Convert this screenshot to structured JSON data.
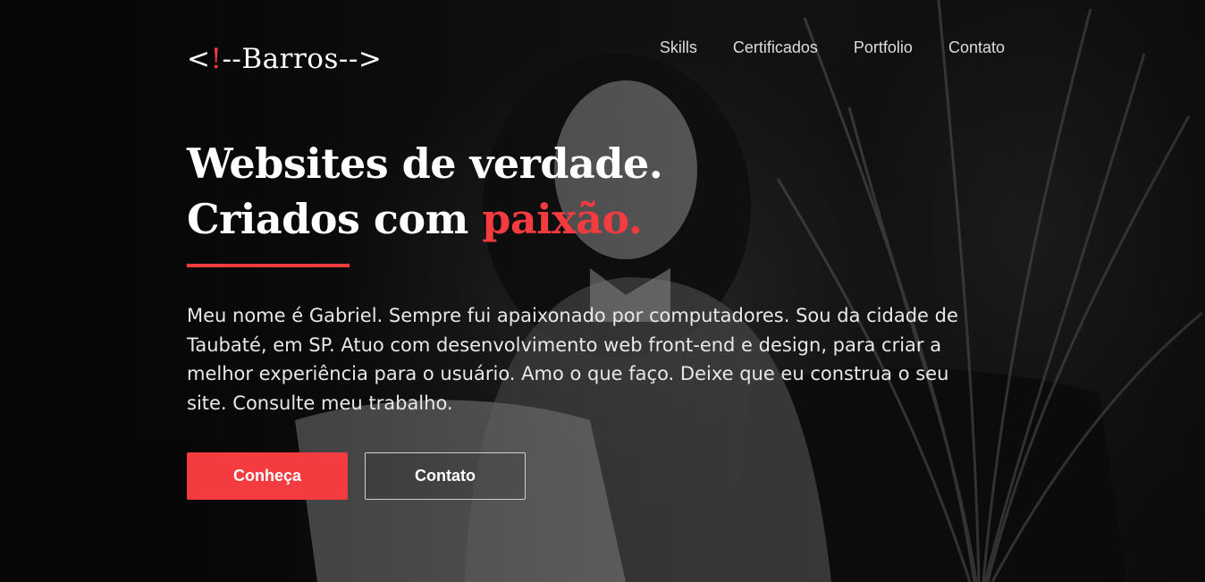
{
  "logo": {
    "prefix": "<",
    "bang": "!",
    "suffix": "--Barros-->"
  },
  "nav": {
    "items": [
      {
        "label": "Skills"
      },
      {
        "label": "Certificados"
      },
      {
        "label": "Portfolio"
      },
      {
        "label": "Contato"
      }
    ]
  },
  "hero": {
    "line1": "Websites de verdade.",
    "line2_prefix": "Criados com ",
    "line2_accent": "paixão.",
    "intro": "Meu nome é Gabriel. Sempre fui apaixonado por computadores. Sou da cidade de Taubaté, em SP. Atuo com desenvolvimento web front-end e design, para criar a melhor experiência para o usuário. Amo o que faço. Deixe que eu construa o seu site. Consulte meu trabalho.",
    "buttons": {
      "primary": "Conheça",
      "secondary": "Contato"
    }
  },
  "colors": {
    "accent": "#f33b40",
    "background": "#0c0c0c",
    "text": "#ffffff"
  }
}
